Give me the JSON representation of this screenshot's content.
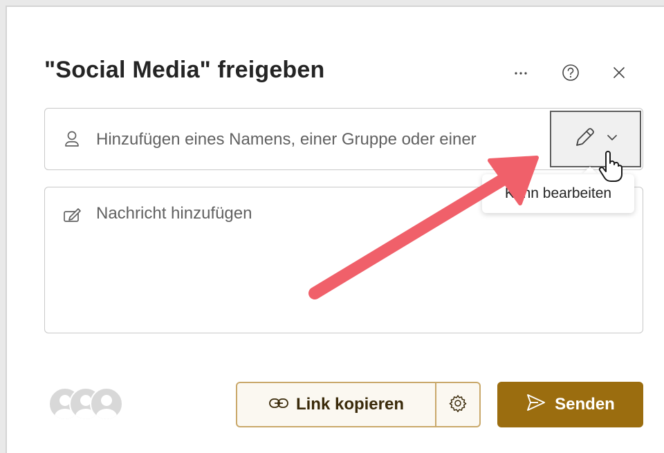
{
  "dialog": {
    "title": "\"Social Media\" freigeben",
    "more_icon": "more-icon",
    "help_icon": "help-icon",
    "close_icon": "close-icon"
  },
  "people": {
    "placeholder": "Hinzufügen eines Namens, einer Gruppe oder einer",
    "icon": "person-icon",
    "permission": {
      "icon": "pencil-icon",
      "dropdown_icon": "chevron-down-icon"
    }
  },
  "tooltip": {
    "text": "Kann bearbeiten"
  },
  "message": {
    "placeholder": "Nachricht hinzufügen",
    "icon": "compose-icon"
  },
  "footer": {
    "avatars": [
      "avatar",
      "avatar",
      "avatar"
    ],
    "copy_link_label": "Link kopieren",
    "settings_icon": "gear-icon",
    "send_label": "Senden"
  },
  "colors": {
    "accent": "#9b6d0f",
    "accent_border": "#c9a86a",
    "arrow": "#f0606a"
  }
}
